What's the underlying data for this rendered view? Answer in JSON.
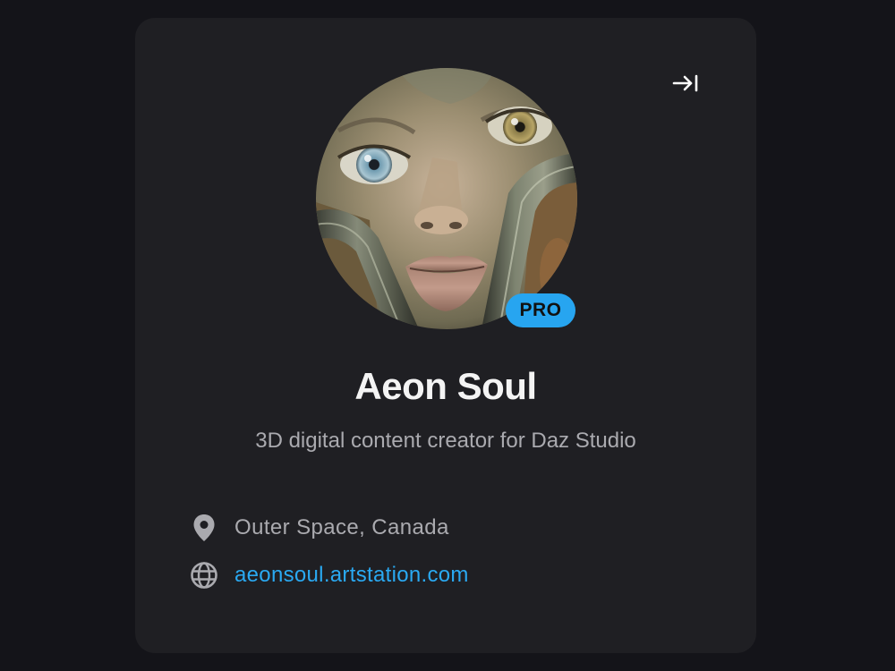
{
  "profile": {
    "name": "Aeon Soul",
    "tagline": "3D digital content creator for Daz Studio",
    "badge": "PRO",
    "location": "Outer Space, Canada",
    "website": "aeonsoul.artstation.com",
    "avatar_alt": "Aeon Soul avatar"
  },
  "icons": {
    "collapse": "collapse-right-icon",
    "location": "map-pin-icon",
    "website": "globe-icon"
  },
  "colors": {
    "page_background": "#141419",
    "card_background": "#1f1f23",
    "accent": "#27a5f0",
    "link": "#2aa9f2",
    "name_text": "#f4f4f4",
    "muted_text": "#aaaaaf"
  }
}
